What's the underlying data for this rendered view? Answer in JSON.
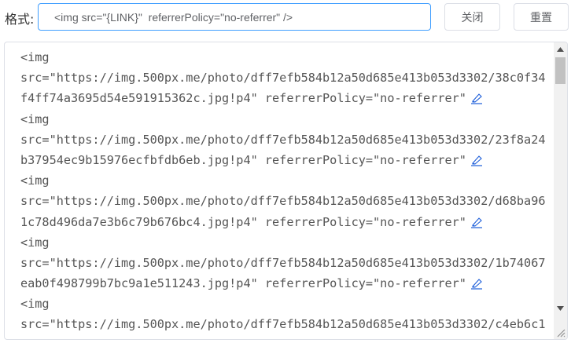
{
  "toolbar": {
    "format_label": "格式:",
    "format_value": "<img src=\"{LINK}\"  referrerPolicy=\"no-referrer\" />",
    "close_label": "关闭",
    "reset_label": "重置"
  },
  "output": {
    "entries": [
      {
        "line1": "<img",
        "line2": "src=\"https://img.500px.me/photo/dff7efb584b12a50d685e413b053d3302/38c0f34",
        "line3": "f4ff74a3695d54e591915362c.jpg!p4\"  referrerPolicy=\"no-referrer\""
      },
      {
        "line1": "<img",
        "line2": "src=\"https://img.500px.me/photo/dff7efb584b12a50d685e413b053d3302/23f8a24",
        "line3": "b37954ec9b15976ecfbfdb6eb.jpg!p4\"  referrerPolicy=\"no-referrer\""
      },
      {
        "line1": "<img",
        "line2": "src=\"https://img.500px.me/photo/dff7efb584b12a50d685e413b053d3302/d68ba96",
        "line3": "1c78d496da7e3b6c79b676bc4.jpg!p4\"  referrerPolicy=\"no-referrer\""
      },
      {
        "line1": "<img",
        "line2": "src=\"https://img.500px.me/photo/dff7efb584b12a50d685e413b053d3302/1b74067",
        "line3": "eab0f498799b7bc9a1e511243.jpg!p4\"  referrerPolicy=\"no-referrer\""
      },
      {
        "line1": "<img",
        "line2": "src=\"https://img.500px.me/photo/dff7efb584b12a50d685e413b053d3302/c4eb6c1"
      }
    ]
  },
  "colors": {
    "accent": "#409eff",
    "border": "#dcdfe6",
    "text": "#555555",
    "edit_icon": "#1a5cd9"
  },
  "icons": {
    "edit": "edit-pen-icon",
    "scroll_up": "scroll-up-arrow-icon",
    "scroll_down": "scroll-down-arrow-icon",
    "resize": "resize-grip-icon"
  }
}
